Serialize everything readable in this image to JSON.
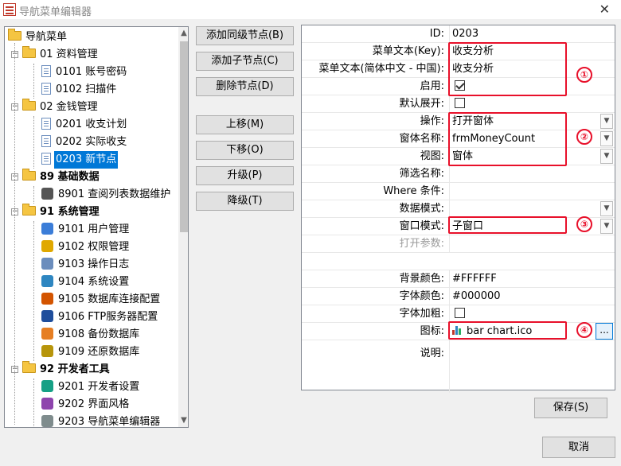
{
  "window": {
    "title": "导航菜单编辑器",
    "close_label": "✕"
  },
  "tree": {
    "root_label": "导航菜单",
    "rows": [
      {
        "label": "01 资料管理",
        "level": 1,
        "icon": "folder-icon",
        "expander": "-"
      },
      {
        "label": "0101 账号密码",
        "level": 2,
        "icon": "doc-icon"
      },
      {
        "label": "0102 扫描件",
        "level": 2,
        "icon": "doc-icon"
      },
      {
        "label": "02 金钱管理",
        "level": 1,
        "icon": "folder-icon",
        "expander": "-"
      },
      {
        "label": "0201 收支计划",
        "level": 2,
        "icon": "doc-icon"
      },
      {
        "label": "0202 实际收支",
        "level": 2,
        "icon": "doc-icon"
      },
      {
        "label": "0203 新节点",
        "level": 2,
        "icon": "doc-icon",
        "selected": true
      },
      {
        "label": "89 基础数据",
        "level": 1,
        "icon": "folder-icon",
        "expander": "-",
        "bold": true
      },
      {
        "label": "8901 查阅列表数据维护",
        "level": 2,
        "icon": "table-icon"
      },
      {
        "label": "91 系统管理",
        "level": 1,
        "icon": "folder-icon",
        "expander": "-",
        "bold": true
      },
      {
        "label": "9101 用户管理",
        "level": 2,
        "icon": "users-icon"
      },
      {
        "label": "9102 权限管理",
        "level": 2,
        "icon": "lock-icon"
      },
      {
        "label": "9103 操作日志",
        "level": 2,
        "icon": "log-icon"
      },
      {
        "label": "9104 系统设置",
        "level": 2,
        "icon": "settings-icon"
      },
      {
        "label": "9105 数据库连接配置",
        "level": 2,
        "icon": "db-icon"
      },
      {
        "label": "9106 FTP服务器配置",
        "level": 2,
        "icon": "server-icon"
      },
      {
        "label": "9108 备份数据库",
        "level": 2,
        "icon": "backup-icon"
      },
      {
        "label": "9109 还原数据库",
        "level": 2,
        "icon": "restore-icon"
      },
      {
        "label": "92 开发者工具",
        "level": 1,
        "icon": "folder-icon",
        "expander": "-",
        "bold": true
      },
      {
        "label": "9201 开发者设置",
        "level": 2,
        "icon": "dev-icon"
      },
      {
        "label": "9202 界面风格",
        "level": 2,
        "icon": "style-icon"
      },
      {
        "label": "9203 导航菜单编辑器",
        "level": 2,
        "icon": "editor-icon"
      }
    ]
  },
  "buttons": {
    "add_sibling": "添加同级节点(B)",
    "add_child": "添加子节点(C)",
    "delete_node": "删除节点(D)",
    "move_up": "上移(M)",
    "move_down": "下移(O)",
    "promote": "升级(P)",
    "demote": "降级(T)",
    "save": "保存(S)",
    "cancel": "取消"
  },
  "props": {
    "id": {
      "label": "ID:",
      "value": "0203"
    },
    "menu_text_key": {
      "label": "菜单文本(Key):",
      "value": "收支分析"
    },
    "menu_text_zh": {
      "label": "菜单文本(简体中文 - 中国):",
      "value": "收支分析"
    },
    "enabled": {
      "label": "启用:",
      "checked": true
    },
    "default_expand": {
      "label": "默认展开:",
      "checked": false
    },
    "operation": {
      "label": "操作:",
      "value": "打开窗体"
    },
    "form_name": {
      "label": "窗体名称:",
      "value": "frmMoneyCount"
    },
    "view": {
      "label": "视图:",
      "value": "窗体"
    },
    "filter_name": {
      "label": "筛选名称:",
      "value": ""
    },
    "where": {
      "label": "Where 条件:",
      "value": ""
    },
    "data_mode": {
      "label": "数据模式:",
      "value": ""
    },
    "window_mode": {
      "label": "窗口模式:",
      "value": "子窗口"
    },
    "open_params": {
      "label": "打开参数:",
      "value": ""
    },
    "bg_color": {
      "label": "背景颜色:",
      "value": "#FFFFFF"
    },
    "font_color": {
      "label": "字体颜色:",
      "value": "#000000"
    },
    "font_bold": {
      "label": "字体加粗:",
      "checked": false
    },
    "icon": {
      "label": "图标:",
      "value": "bar chart.ico",
      "button": "..."
    },
    "description": {
      "label": "说明:",
      "value": ""
    }
  },
  "annotations": [
    "①",
    "②",
    "③",
    "④"
  ],
  "colors": {
    "selection": "#0078d7",
    "annotation_red": "#e8102a"
  }
}
